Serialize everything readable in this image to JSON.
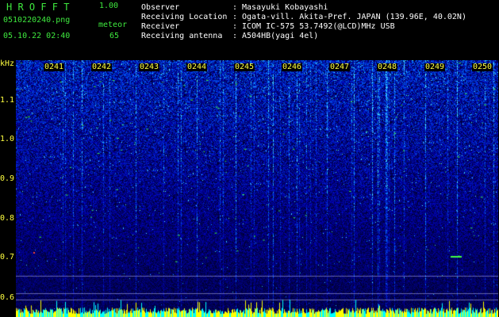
{
  "header": {
    "app_title": "H R O F F T",
    "version": "1.00",
    "filename": "0510220240.png",
    "datetime": "05.10.22 02:40",
    "meteor_label": "meteor",
    "meteor_count": "65"
  },
  "info": [
    {
      "key": "Observer",
      "sep": ":",
      "value": "Masayuki Kobayashi"
    },
    {
      "key": "Receiving Location",
      "sep": ":",
      "value": "Ogata-vill. Akita-Pref. JAPAN (139.96E, 40.02N)"
    },
    {
      "key": "Receiver",
      "sep": ":",
      "value": "ICOM IC-575 53.7492(@LCD)MHz USB"
    },
    {
      "key": "Receiving antenna",
      "sep": ":",
      "value": "A504HB(yagi 4el)"
    }
  ],
  "y_axis": {
    "unit": "kHz",
    "ticks": [
      "1.1",
      "1.0",
      "0.9",
      "0.8",
      "0.7",
      "0.6"
    ]
  },
  "time_axis": {
    "ticks": [
      "0241",
      "0242",
      "0243",
      "0244",
      "0245",
      "0246",
      "0247",
      "0248",
      "0249",
      "0250"
    ]
  },
  "colors": {
    "background": "#000000",
    "header_text": "#3ee83e",
    "info_text": "#ffffff",
    "axis_text": "#ffff40",
    "spectrum_low": "#000060",
    "spectrum_mid": "#1a3cff",
    "spectrum_high": "#00e0ff",
    "meteor_echo": "#40ff40",
    "baseline": "#ffff00"
  }
}
